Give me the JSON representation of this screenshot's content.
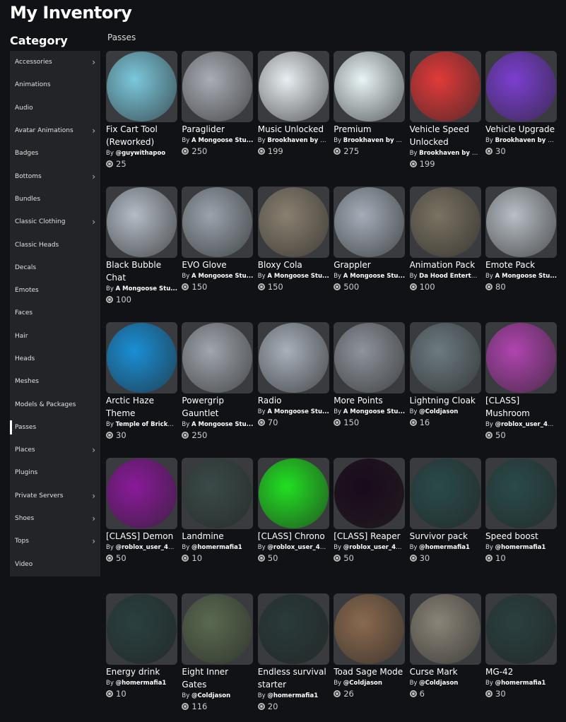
{
  "title": "My Inventory",
  "category_title": "Category",
  "section": "Passes",
  "sidebar": [
    {
      "label": "Accessories",
      "chevron": true
    },
    {
      "label": "Animations"
    },
    {
      "label": "Audio"
    },
    {
      "label": "Avatar Animations",
      "chevron": true
    },
    {
      "label": "Badges"
    },
    {
      "label": "Bottoms",
      "chevron": true
    },
    {
      "label": "Bundles"
    },
    {
      "label": "Classic Clothing",
      "chevron": true
    },
    {
      "label": "Classic Heads"
    },
    {
      "label": "Decals"
    },
    {
      "label": "Emotes"
    },
    {
      "label": "Faces"
    },
    {
      "label": "Hair"
    },
    {
      "label": "Heads"
    },
    {
      "label": "Meshes"
    },
    {
      "label": "Models & Packages"
    },
    {
      "label": "Passes",
      "active": true
    },
    {
      "label": "Places",
      "chevron": true
    },
    {
      "label": "Plugins"
    },
    {
      "label": "Private Servers",
      "chevron": true
    },
    {
      "label": "Shoes",
      "chevron": true
    },
    {
      "label": "Tops",
      "chevron": true
    },
    {
      "label": "Video"
    }
  ],
  "items": [
    {
      "name": "Fix Cart Tool (Reworked)",
      "creator": "@guywithapoo",
      "price": "25",
      "color": "#7cc8dc"
    },
    {
      "name": "Paraglider",
      "creator": "A Mongoose Stu...",
      "price": "250",
      "color": "#a9adb5"
    },
    {
      "name": "Music Unlocked",
      "creator": "Brookhaven by V...",
      "price": "199",
      "color": "#e8eef2"
    },
    {
      "name": "Premium",
      "creator": "Brookhaven by V...",
      "price": "275",
      "color": "#e8f4f6"
    },
    {
      "name": "Vehicle Speed Unlocked",
      "creator": "Brookhaven by V...",
      "price": "199",
      "color": "#e23a3a"
    },
    {
      "name": "Vehicle Upgrade",
      "creator": "Brookhaven by V...",
      "price": "30",
      "color": "#7b3fd0"
    },
    {
      "name": "Black Bubble Chat",
      "creator": "A Mongoose Stu...",
      "price": "100",
      "color": "#b4bcc6"
    },
    {
      "name": "EVO Glove",
      "creator": "A Mongoose Stu...",
      "price": "150",
      "color": "#9aa3ad"
    },
    {
      "name": "Bloxy Cola",
      "creator": "A Mongoose Stu...",
      "price": "150",
      "color": "#8a8070"
    },
    {
      "name": "Grappler",
      "creator": "A Mongoose Stu...",
      "price": "500",
      "color": "#a4adb8"
    },
    {
      "name": "Animation Pack",
      "creator": "Da Hood Entertai...",
      "price": "100",
      "color": "#7a7262"
    },
    {
      "name": "Emote Pack",
      "creator": "A Mongoose Stu...",
      "price": "80",
      "color": "#b8bfc6"
    },
    {
      "name": "Arctic Haze Theme",
      "creator": "Temple of Brickb...",
      "price": "30",
      "color": "#1a8fd6"
    },
    {
      "name": "Powergrip Gauntlet",
      "creator": "A Mongoose Stu...",
      "price": "250",
      "color": "#a0a6ae"
    },
    {
      "name": "Radio",
      "creator": "A Mongoose Stu...",
      "price": "70",
      "color": "#a8b0ba"
    },
    {
      "name": "More Points",
      "creator": "A Mongoose Stu...",
      "price": "150",
      "color": "#8e949c"
    },
    {
      "name": "Lightning Cloak",
      "creator": "@Coldjason",
      "price": "16",
      "color": "#6c7a80"
    },
    {
      "name": "[CLASS] Mushroom",
      "creator": "@roblox_user_40...",
      "price": "50",
      "color": "#b044b0"
    },
    {
      "name": "[CLASS] Demon",
      "creator": "@roblox_user_40...",
      "price": "50",
      "color": "#8a1a9a"
    },
    {
      "name": "Landmine",
      "creator": "@homermafia1",
      "price": "10",
      "color": "#3a4a48"
    },
    {
      "name": "[CLASS] Chrono",
      "creator": "@roblox_user_40...",
      "price": "50",
      "color": "#22e022"
    },
    {
      "name": "[CLASS] Reaper",
      "creator": "@roblox_user_40...",
      "price": "50",
      "color": "#1a0a1c"
    },
    {
      "name": "Survivor pack",
      "creator": "@homermafia1",
      "price": "30",
      "color": "#2a4a4a"
    },
    {
      "name": "Speed boost",
      "creator": "@homermafia1",
      "price": "10",
      "color": "#2a4a4a"
    },
    {
      "name": "Energy drink",
      "creator": "@homermafia1",
      "price": "10",
      "color": "#2a4040"
    },
    {
      "name": "Eight Inner Gates",
      "creator": "@Coldjason",
      "price": "116",
      "color": "#5a6a50"
    },
    {
      "name": "Endless survival starter",
      "creator": "@homermafia1",
      "price": "20",
      "color": "#2a3a3a"
    },
    {
      "name": "Toad Sage Mode",
      "creator": "@Coldjason",
      "price": "26",
      "color": "#8a6a50"
    },
    {
      "name": "Curse Mark",
      "creator": "@Coldjason",
      "price": "6",
      "color": "#8a8478"
    },
    {
      "name": "MG-42",
      "creator": "@homermafia1",
      "price": "30",
      "color": "#2a4040"
    }
  ],
  "by_prefix": "By"
}
